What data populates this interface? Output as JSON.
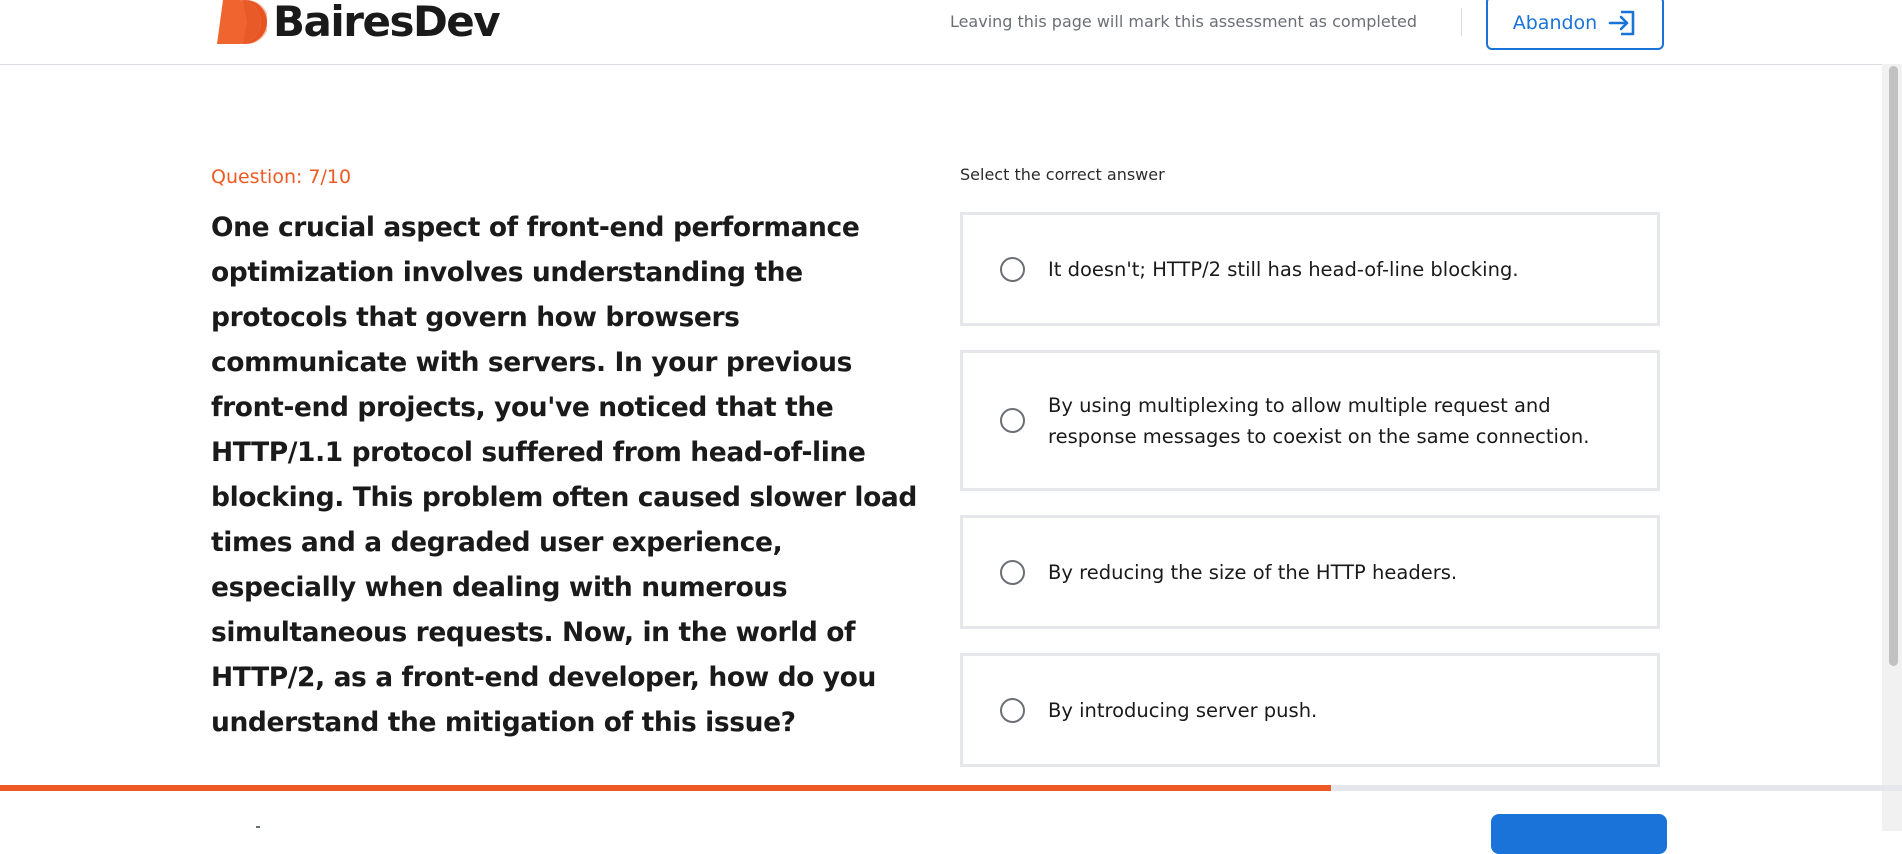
{
  "header": {
    "brand_name": "BairesDev",
    "leaving_notice": "Leaving this page will mark this assessment as completed",
    "abandon_label": "Abandon",
    "brand_color": "#ee5a24",
    "accent_color": "#1a73d9"
  },
  "question": {
    "number_label": "Question: 7/10",
    "text": "One crucial aspect of front-end performance optimization involves understanding the protocols that govern how browsers communicate with servers. In your previous front-end projects, you've noticed that the HTTP/1.1 protocol suffered from head-of-line blocking. This problem often caused slower load times and a degraded user experience, especially when dealing with numerous simultaneous requests. Now, in the world of HTTP/2, as a front-end developer, how do you understand the mitigation of this issue?"
  },
  "answers": {
    "instruction": "Select the correct answer",
    "options": [
      {
        "label": "It doesn't; HTTP/2 still has head-of-line blocking.",
        "selected": false
      },
      {
        "label": "By using multiplexing to allow multiple request and response messages to coexist on the same connection.",
        "selected": false
      },
      {
        "label": "By reducing the size of the HTTP headers.",
        "selected": false
      },
      {
        "label": "By introducing server push.",
        "selected": false
      }
    ]
  },
  "progress": {
    "fraction": 0.7
  },
  "icons": {
    "abandon": "exit-arrow-icon",
    "logo": "bairesdev-logo-icon",
    "radio": "radio-unchecked-icon"
  }
}
